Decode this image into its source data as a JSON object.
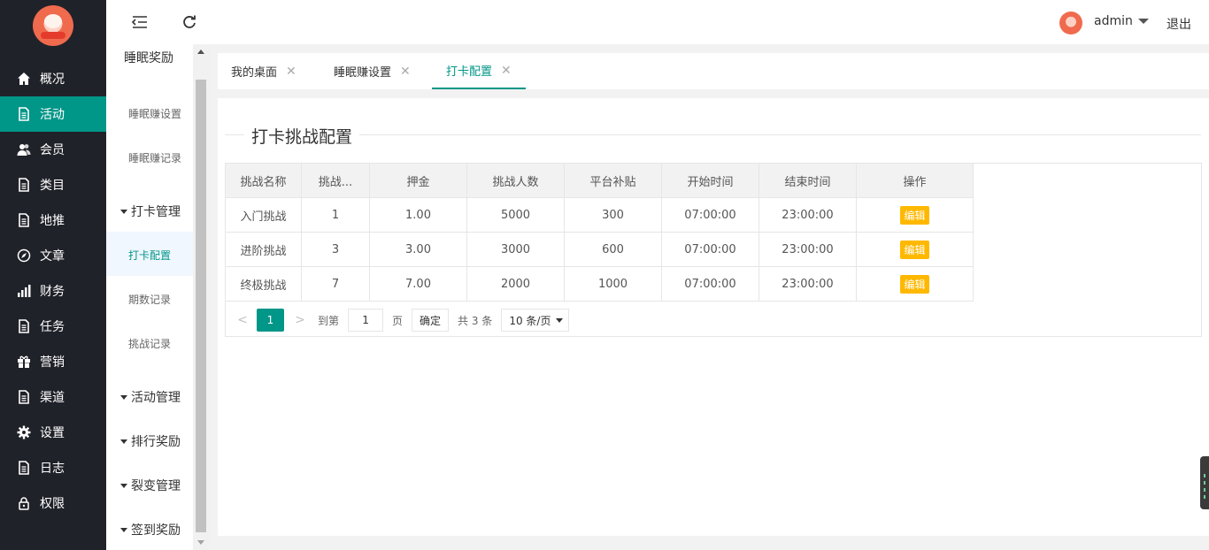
{
  "nav": {
    "items": [
      {
        "label": "概况",
        "icon": "home-icon"
      },
      {
        "label": "活动",
        "icon": "file-icon",
        "active": true
      },
      {
        "label": "会员",
        "icon": "users-icon"
      },
      {
        "label": "类目",
        "icon": "file-icon"
      },
      {
        "label": "地推",
        "icon": "file-icon"
      },
      {
        "label": "文章",
        "icon": "compass-icon"
      },
      {
        "label": "财务",
        "icon": "bar-chart-icon"
      },
      {
        "label": "任务",
        "icon": "file-icon"
      },
      {
        "label": "营销",
        "icon": "gift-icon"
      },
      {
        "label": "渠道",
        "icon": "file-icon"
      },
      {
        "label": "设置",
        "icon": "gear-icon"
      },
      {
        "label": "日志",
        "icon": "file-icon"
      },
      {
        "label": "权限",
        "icon": "lock-icon"
      }
    ]
  },
  "subnav": {
    "title": "睡眠奖励",
    "links_top": [
      "睡眠赚设置",
      "睡眠赚记录"
    ],
    "group_checkin": "打卡管理",
    "checkin_links": [
      "打卡配置",
      "期数记录",
      "挑战记录"
    ],
    "groups_bottom": [
      "活动管理",
      "排行奖励",
      "裂变管理",
      "签到奖励"
    ]
  },
  "header": {
    "username": "admin",
    "logout": "退出"
  },
  "tabs": [
    {
      "label": "我的桌面"
    },
    {
      "label": "睡眠赚设置"
    },
    {
      "label": "打卡配置",
      "active": true
    }
  ],
  "card": {
    "legend": "打卡挑战配置"
  },
  "table": {
    "headers": [
      "挑战名称",
      "挑战...",
      "押金",
      "挑战人数",
      "平台补贴",
      "开始时间",
      "结束时间",
      "操作"
    ],
    "rows": [
      [
        "入门挑战",
        "1",
        "1.00",
        "5000",
        "300",
        "07:00:00",
        "23:00:00",
        "编辑"
      ],
      [
        "进阶挑战",
        "3",
        "3.00",
        "3000",
        "600",
        "07:00:00",
        "23:00:00",
        "编辑"
      ],
      [
        "终极挑战",
        "7",
        "7.00",
        "2000",
        "1000",
        "07:00:00",
        "23:00:00",
        "编辑"
      ]
    ]
  },
  "pager": {
    "current": "1",
    "goto_label": "到第",
    "goto_value": "1",
    "page_unit": "页",
    "confirm": "确定",
    "total": "共 3 条",
    "per_page": "10 条/页"
  },
  "colors": {
    "accent": "#009688",
    "edit": "#ffb800",
    "sidebar": "#20222a"
  }
}
